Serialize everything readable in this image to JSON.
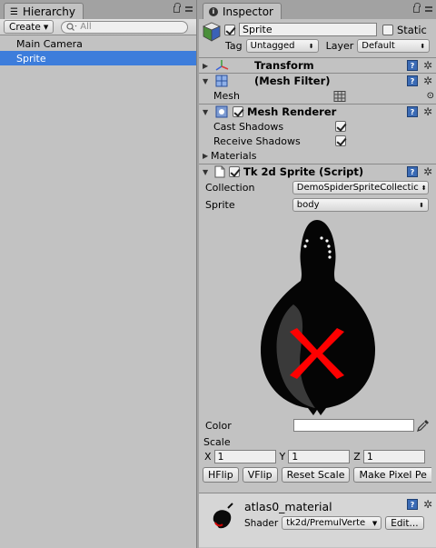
{
  "hierarchy": {
    "tab_label": "Hierarchy",
    "create_label": "Create",
    "search_placeholder": "All",
    "items": [
      {
        "label": "Main Camera"
      },
      {
        "label": "Sprite"
      }
    ]
  },
  "inspector": {
    "tab_label": "Inspector",
    "gameobject": {
      "name": "Sprite",
      "static_label": "Static",
      "tag_label": "Tag",
      "tag_value": "Untagged",
      "layer_label": "Layer",
      "layer_value": "Default"
    },
    "transform": {
      "title": "Transform"
    },
    "mesh_filter": {
      "title": "(Mesh Filter)",
      "mesh_label": "Mesh"
    },
    "mesh_renderer": {
      "title": "Mesh Renderer",
      "cast_shadows_label": "Cast Shadows",
      "receive_shadows_label": "Receive Shadows",
      "materials_label": "Materials"
    },
    "tk2d": {
      "title": "Tk 2d Sprite (Script)",
      "collection_label": "Collection",
      "collection_value": "DemoSpiderSpriteCollectic",
      "sprite_label": "Sprite",
      "sprite_value": "body",
      "color_label": "Color",
      "scale_label": "Scale",
      "x_label": "X",
      "x_value": "1",
      "y_label": "Y",
      "y_value": "1",
      "z_label": "Z",
      "z_value": "1",
      "buttons": [
        "HFlip",
        "VFlip",
        "Reset Scale",
        "Make Pixel Pe"
      ]
    },
    "material": {
      "name": "atlas0_material",
      "shader_label": "Shader",
      "shader_value": "tk2d/PremulVerte",
      "edit_label": "Edit..."
    }
  },
  "colors": {
    "selection": "#3d7ddb",
    "panel": "#c2c2c2",
    "sprite_body": "#050505",
    "sprite_cross": "#ff0000"
  }
}
